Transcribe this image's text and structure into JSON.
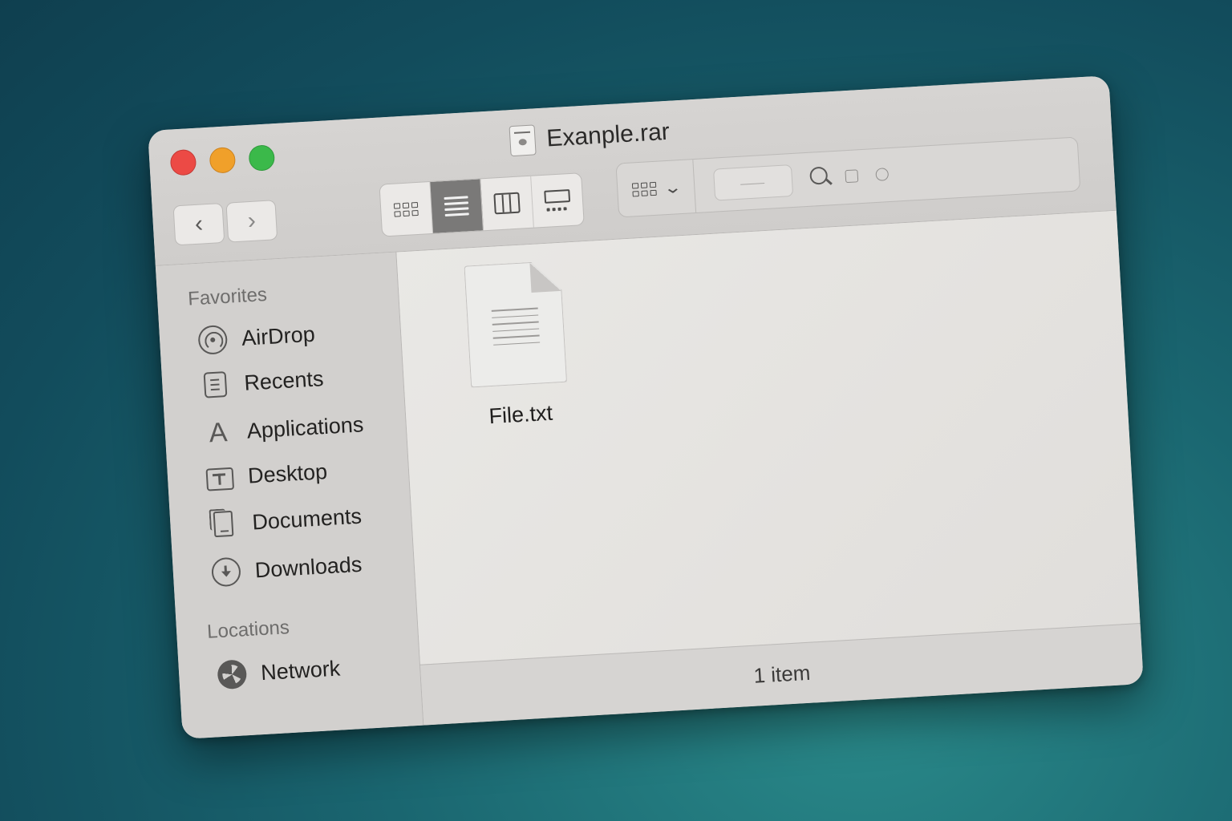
{
  "window": {
    "title": "Exanple.rar"
  },
  "toolbar": {
    "back_icon": "chevron-left-icon",
    "forward_icon": "chevron-right-icon",
    "view_modes": [
      "icon-view",
      "list-view",
      "column-view",
      "gallery-view"
    ],
    "active_view": "list-view",
    "group_icon": "group-by-icon",
    "search_icon": "search-icon"
  },
  "sidebar": {
    "favorites_heading": "Favorites",
    "favorites": [
      {
        "label": "AirDrop",
        "icon": "airdrop-icon"
      },
      {
        "label": "Recents",
        "icon": "recents-icon"
      },
      {
        "label": "Applications",
        "icon": "applications-icon"
      },
      {
        "label": "Desktop",
        "icon": "desktop-icon"
      },
      {
        "label": "Documents",
        "icon": "documents-icon"
      },
      {
        "label": "Downloads",
        "icon": "downloads-icon"
      }
    ],
    "locations_heading": "Locations",
    "locations": [
      {
        "label": "Network",
        "icon": "network-icon"
      }
    ]
  },
  "content": {
    "files": [
      {
        "name": "File.txt",
        "icon": "text-document-icon"
      }
    ]
  },
  "status": {
    "text": "1 item"
  },
  "colors": {
    "close": "#ec4a45",
    "minimize": "#f0a02a",
    "zoom": "#3bb94a",
    "desktop_background": "#1a6670"
  }
}
